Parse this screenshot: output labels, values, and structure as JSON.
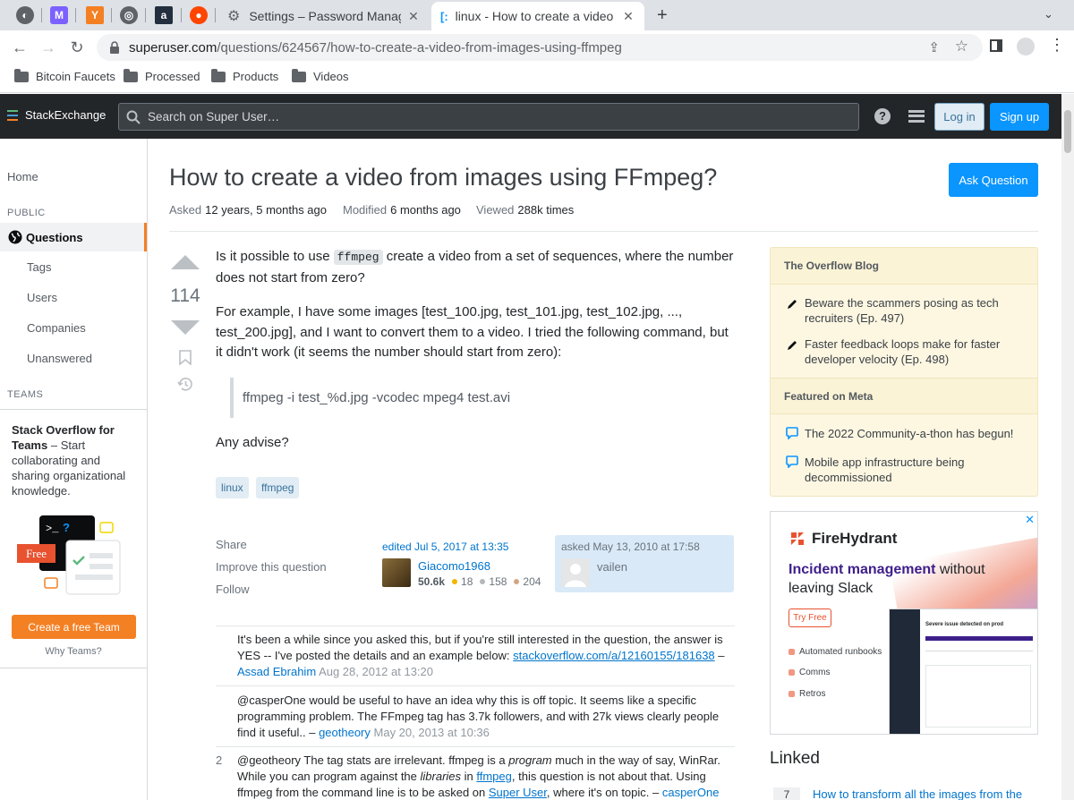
{
  "browser": {
    "tabs": [
      {
        "title": "Settings – Password Manager"
      },
      {
        "title": "linux - How to create a video fro"
      }
    ],
    "url_domain": "superuser.com",
    "url_path": "/questions/624567/how-to-create-a-video-from-images-using-ffmpeg",
    "bookmarks": [
      "Bitcoin Faucets",
      "Processed",
      "Products",
      "Videos"
    ]
  },
  "header": {
    "logo_a": "Stack",
    "logo_b": "Exchange",
    "search_placeholder": "Search on Super User…",
    "login": "Log in",
    "signup": "Sign up"
  },
  "nav": {
    "home": "Home",
    "public": "PUBLIC",
    "questions": "Questions",
    "tags": "Tags",
    "users": "Users",
    "companies": "Companies",
    "unanswered": "Unanswered",
    "teams": "TEAMS",
    "teams_title": "Stack Overflow for Teams",
    "teams_text": " – Start collaborating and sharing organizational knowledge.",
    "teams_free": "Free",
    "teams_btn": "Create a free Team",
    "why": "Why Teams?"
  },
  "question": {
    "title": "How to create a video from images using FFmpeg?",
    "ask_button": "Ask Question",
    "asked_k": "Asked",
    "asked_v": "12 years, 5 months ago",
    "modified_k": "Modified",
    "modified_v": "6 months ago",
    "viewed_k": "Viewed",
    "viewed_v": "288k times",
    "votes": "114",
    "p1a": "Is it possible to use ",
    "p1code": "ffmpeg",
    "p1b": " create a video from a set of sequences, where the number does not start from zero?",
    "p2": "For example, I have some images [test_100.jpg, test_101.jpg, test_102.jpg, ..., test_200.jpg], and I want to convert them to a video. I tried the following command, but it didn't work (it seems the number should start from zero):",
    "quote": "ffmpeg -i test_%d.jpg -vcodec mpeg4 test.avi",
    "p3": "Any advise?",
    "tags": [
      "linux",
      "ffmpeg"
    ],
    "share": "Share",
    "improve": "Improve this question",
    "follow": "Follow",
    "edited": "edited Jul 5, 2017 at 13:35",
    "editor_name": "Giacomo1968",
    "editor_rep": "50.6k",
    "editor_gold": "18",
    "editor_silver": "158",
    "editor_bronze": "204",
    "asked_stamp": "asked May 13, 2010 at 17:58",
    "owner_name": "vailen"
  },
  "comments": [
    {
      "text": "It's been a while since you asked this, but if you're still interested in the question, the answer is YES -- I've posted the details and an example below: ",
      "link": "stackoverflow.com/a/12160155/181638",
      "user": "Assad Ebrahim",
      "date": "Aug 28, 2012 at 13:20"
    },
    {
      "text": "@casperOne would be useful to have an idea why this is off topic. It seems like a specific programming problem. The FFmpeg tag has 3.7k followers, and with 27k views clearly people find it useful.. – ",
      "user": "geotheory",
      "date": "May 20, 2013 at 10:36"
    },
    {
      "score": "2",
      "t1": "@geotheory The tag stats are irrelevant. ffmpeg is a ",
      "em1": "program",
      "t2": " much in the way of say, WinRar. While you can program against the ",
      "em2": "libraries",
      "t3": " in ",
      "link1": "ffmpeg",
      "t4": ", this question is not about that. Using ffmpeg from the command line is to be asked on ",
      "link2": "Super User",
      "t5": ", where it's on topic. – ",
      "user": "casperOne"
    }
  ],
  "sidebar": {
    "blog_head": "The Overflow Blog",
    "blog1": "Beware the scammers posing as tech recruiters (Ep. 497)",
    "blog2": "Faster feedback loops make for faster developer velocity (Ep. 498)",
    "meta_head": "Featured on Meta",
    "meta1": "The 2022 Community-a-thon has begun!",
    "meta2": "Mobile app infrastructure being decommissioned",
    "ad_brand": "FireHydrant",
    "ad_accent": "Incident management",
    "ad_rest": " without leaving Slack",
    "ad_try": "Try Free",
    "ad_f1": "Automated runbooks",
    "ad_f2": "Comms",
    "ad_f3": "Retros",
    "ad_shot_title": "Severe issue detected on prod",
    "linked": "Linked",
    "linked_count": "7",
    "linked_link": "How to transform all the images from the"
  },
  "colors": {
    "accent": "#f48024",
    "link": "#0074cc",
    "primary_button": "#0a95ff",
    "header_bg": "#232629"
  }
}
